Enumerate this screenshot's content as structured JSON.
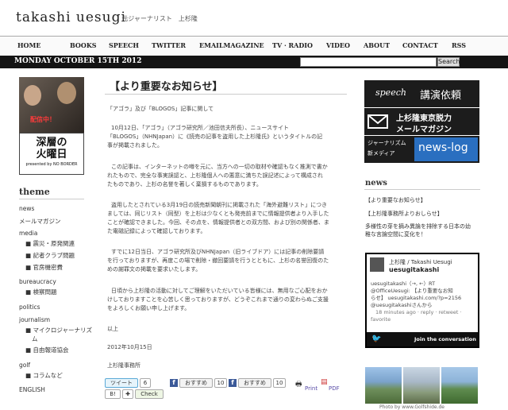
{
  "site": {
    "logo": "takashi uesugi",
    "subtitle": "| 元ジャーナリスト　上杉隆"
  },
  "nav": [
    "HOME",
    "BOOKS",
    "SPEECH",
    "TWITTER",
    "EMAILMAGAZINE",
    "TV · RADIO",
    "VIDEO",
    "ABOUT",
    "CONTACT",
    "RSS"
  ],
  "datebar": {
    "date": "MONDAY OCTOBER 15TH 2012",
    "search_button": "Search"
  },
  "banner": {
    "red_text": "配信中！",
    "title_line1": "深層の",
    "title_line2": "火曜日",
    "credit": "presented by NO BORDER"
  },
  "sidebar": {
    "heading": "theme",
    "items": [
      {
        "label": "news",
        "level": 0
      },
      {
        "label": "メールマガジン",
        "level": 0
      },
      {
        "label": "media",
        "level": 0
      },
      {
        "label": "■ 震災・原発関連",
        "level": 1
      },
      {
        "label": "■ 記者クラブ問題",
        "level": 1
      },
      {
        "label": "■ 官房機密費",
        "level": 1
      },
      {
        "label": "bureaucracy",
        "level": 0
      },
      {
        "label": "■ 検察問題",
        "level": 1
      },
      {
        "label": "politics",
        "level": 0
      },
      {
        "label": "journalism",
        "level": 0
      },
      {
        "label": "■ マイクロジャーナリズ",
        "level": 1
      },
      {
        "label": "ム",
        "level": 2
      },
      {
        "label": "■ 自由報道協会",
        "level": 1
      },
      {
        "label": "golf",
        "level": 0
      },
      {
        "label": "■ コラムなど",
        "level": 1
      },
      {
        "label": "ENGLISH",
        "level": 0
      }
    ]
  },
  "article": {
    "title": "【より重要なお知らせ】",
    "paragraphs": [
      [
        "「アゴラ」及び「BLOGOS」記事に関して"
      ],
      [
        "10月12日、「アゴラ」（アゴラ研究所／池田信夫所長）、ニュースサイト",
        "「BLOGOS」（NHNJapan）に《読売の記事を盗用した上杉隆氏》というタイトルの記",
        "事が掲載されました。"
      ],
      [
        "この記事は、インターネットの噂を元に、当方への一切の取材や確認もなく推測で書か",
        "れたもので、完全な事実誤認と、上杉隆個人への悪意に満ちた誤記述によって構成され",
        "たものであり、上杉の名誉を著しく棄損するものであります。"
      ],
      [
        "盗用したとされている3月19日の読売新聞朝刊に掲載された「海外避難リスト」につき",
        "ましては、同じリスト（同型）を上杉は少なくとも発売前までに情報提供者より入手した",
        "ことが確認できました。今回、その点を、情報提供者との双方間、および別の関係者、ま",
        "た電磁記録によって確認しております。"
      ],
      [
        "すでに12日当日、アゴラ研究所及びNHNJapan（旧ライブドア）には記事の削除要請",
        "を行っておりますが、再度この場で削除・撤回要請を行うとともに、上杉の名誉回復のた",
        "めの謝罪文の掲載を要求いたします。"
      ],
      [
        "日頃から上杉隆の活動に対してご理解をいただいている皆様には、無用なご心配をおか",
        "けしておりますことを心苦しく思っておりますが、どうぞこれまで通りの変わらぬご支援",
        "をよろしくお願い申し上げます。"
      ],
      [
        "以上"
      ],
      [
        "2012年10月15日"
      ],
      [
        "上杉隆事務所"
      ]
    ]
  },
  "share": {
    "tweet": "ツイート",
    "tweet_count": "6",
    "recommend": "おすすめ",
    "recommend_count1": "10",
    "recommend_count2": "10",
    "check": "Check",
    "print": "Print",
    "pdf": "PDF"
  },
  "right": {
    "box1": "講演依頼",
    "box1_en": "speech",
    "box2_line1": "上杉隆東京脱力",
    "box2_line2": "メールマガジン",
    "box3_label1": "ジャーナリズム",
    "box3_label2": "新メディア",
    "box3_main": "news-log",
    "news_heading": "news",
    "news_items": [
      "【より重要なお知らせ】",
      "【上杉隆事務所よりおしらせ】",
      "多様性の芽を摘み異論を排除する日本の幼",
      "稚な言論空間に変化を！"
    ]
  },
  "twitter": {
    "name": "上杉隆 / Takashi Uesugi",
    "handle": "uesugitakashi",
    "lines": [
      "uesugitakashi（→, ←）RT",
      "@OfficeUesugi: 【より重要なお知",
      "らせ】 uesugitakashi.com/?p=2156",
      "@uesugitakashiさんから",
      "18 minutes ago · reply · retweet ·",
      "favorite"
    ],
    "join": "Join the conversation"
  },
  "photo_caption": "Photo by www.Golfshide.de"
}
